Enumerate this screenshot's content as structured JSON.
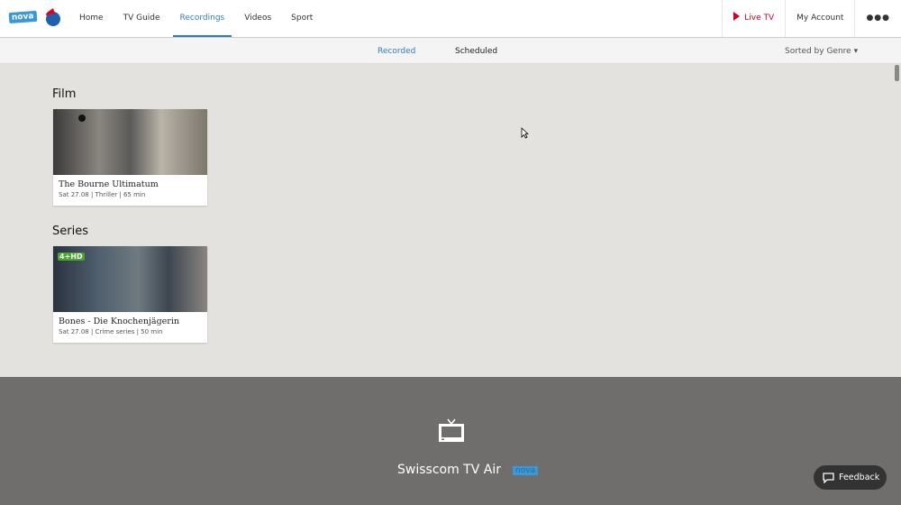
{
  "header": {
    "nova_badge": "nova",
    "nav": [
      "Home",
      "TV Guide",
      "Recordings",
      "Videos",
      "Sport"
    ],
    "active": "Recordings",
    "live_tv": "Live TV",
    "account": "My Account",
    "more": "●●●"
  },
  "subnav": {
    "recorded": "Recorded",
    "scheduled": "Scheduled",
    "sort": "Sorted by Genre ▾"
  },
  "sections": [
    {
      "heading": "Film",
      "items": [
        {
          "title": "The Bourne Ultimatum",
          "meta": "Sat 27.08 | Thriller | 65 min"
        }
      ]
    },
    {
      "heading": "Series",
      "items": [
        {
          "title": "Bones - Die Knochenjägerin",
          "meta": "Sat 27.08 | Crime series | 50 min",
          "channel_badge": "4+HD"
        }
      ]
    }
  ],
  "footer": {
    "brand": "Swisscom TV Air",
    "nova": "nova",
    "feedback": "Feedback"
  },
  "colors": {
    "accent": "#2f7cc4",
    "live": "#d0021b",
    "nova": "#3a98d8"
  }
}
